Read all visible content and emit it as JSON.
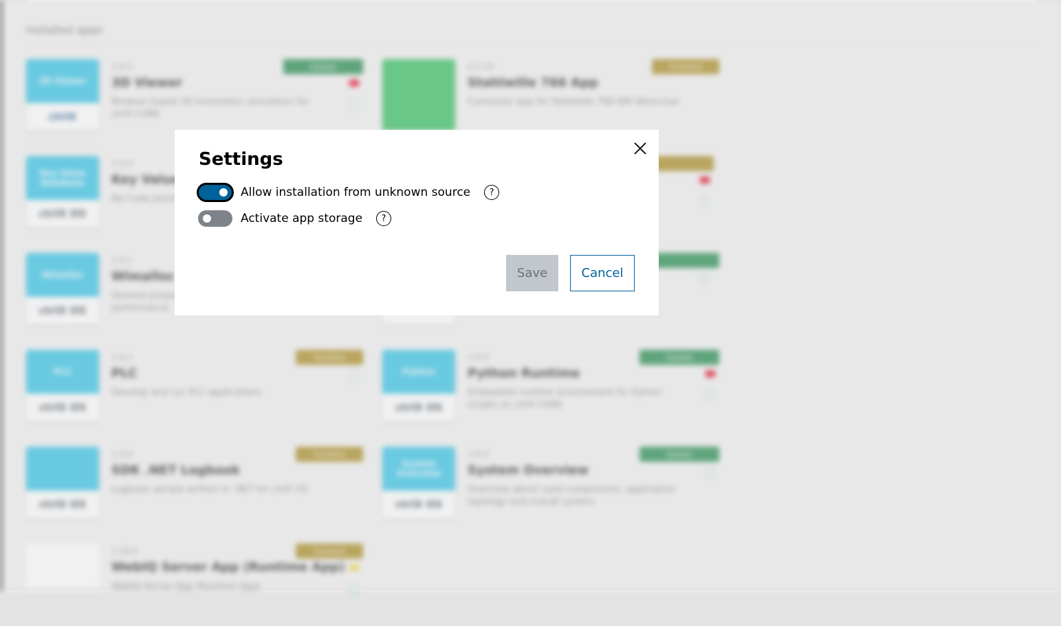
{
  "background": {
    "section_title": "Installed apps",
    "apps": [
      {
        "tile_label": "3D Viewer",
        "tile_foot": "ctrlX",
        "version": "2.6.0",
        "name": "3D Viewer",
        "description": "Browser based 3D kinematics simulation for ctrlX CORE",
        "badge": "Update",
        "badge_color": "#1f8a4a"
      },
      {
        "tile_label": "",
        "tile_foot": "",
        "version": "0.1.10",
        "name": "Stahlwille 766 App",
        "description": "Connector app for Stahlwille 766 WR Wrenches",
        "badge": "Installed",
        "badge_color": "#a98a1e"
      },
      {
        "tile_label": "Key Value Database",
        "tile_foot": "ctrlX OS",
        "version": "2.6.0",
        "name": "Key Value",
        "description": "No Code persistent storage layer",
        "badge": "",
        "badge_color": ""
      },
      {
        "tile_label": "Wimalloc",
        "tile_foot": "ctrlX OS",
        "version": "2.6.1",
        "name": "Wimalloc",
        "description": "General purpose memory allocator with performance",
        "badge": "",
        "badge_color": ""
      },
      {
        "tile_label": "PLC",
        "tile_foot": "ctrlX OS",
        "version": "2.6.2",
        "name": "PLC",
        "description": "Develop and run PLC applications",
        "badge": "Installed",
        "badge_color": "#a98a1e"
      },
      {
        "tile_label": "Python",
        "tile_foot": "ctrlX OS",
        "version": "2.6.0",
        "name": "Python Runtime",
        "description": "Embedded runtime environment for Python scripts on ctrlX CORE",
        "badge": "Update",
        "badge_color": "#1f8a4a"
      },
      {
        "tile_label": "",
        "tile_foot": "ctrlX OS",
        "version": "1.0.0",
        "name": "SDK .NET Logbook",
        "description": "Logbook sample written in .NET for ctrlX OS",
        "badge": "Installed",
        "badge_color": "#a98a1e"
      },
      {
        "tile_label": "System Overview",
        "tile_foot": "ctrlX OS",
        "version": "2.6.0",
        "name": "System Overview",
        "description": "Overview about used components, application topology and overall system",
        "badge": "Update",
        "badge_color": "#1f8a4a"
      },
      {
        "tile_label": "",
        "tile_foot": "",
        "version": "2.18.0",
        "name": "WebIQ Server App (Runtime App)",
        "description": "WebIQ Server App (Runtime App)",
        "badge": "Installed",
        "badge_color": "#a98a1e"
      }
    ]
  },
  "dialog": {
    "title": "Settings",
    "close_icon": "close-icon",
    "options": [
      {
        "label": "Allow installation from unknown source",
        "enabled": true,
        "help": "?"
      },
      {
        "label": "Activate app storage",
        "enabled": false,
        "help": "?"
      }
    ],
    "save_label": "Save",
    "cancel_label": "Cancel"
  },
  "colors": {
    "primary": "#00629a",
    "toggle_off": "#7d8389",
    "save_disabled_bg": "#c1c7cc"
  }
}
